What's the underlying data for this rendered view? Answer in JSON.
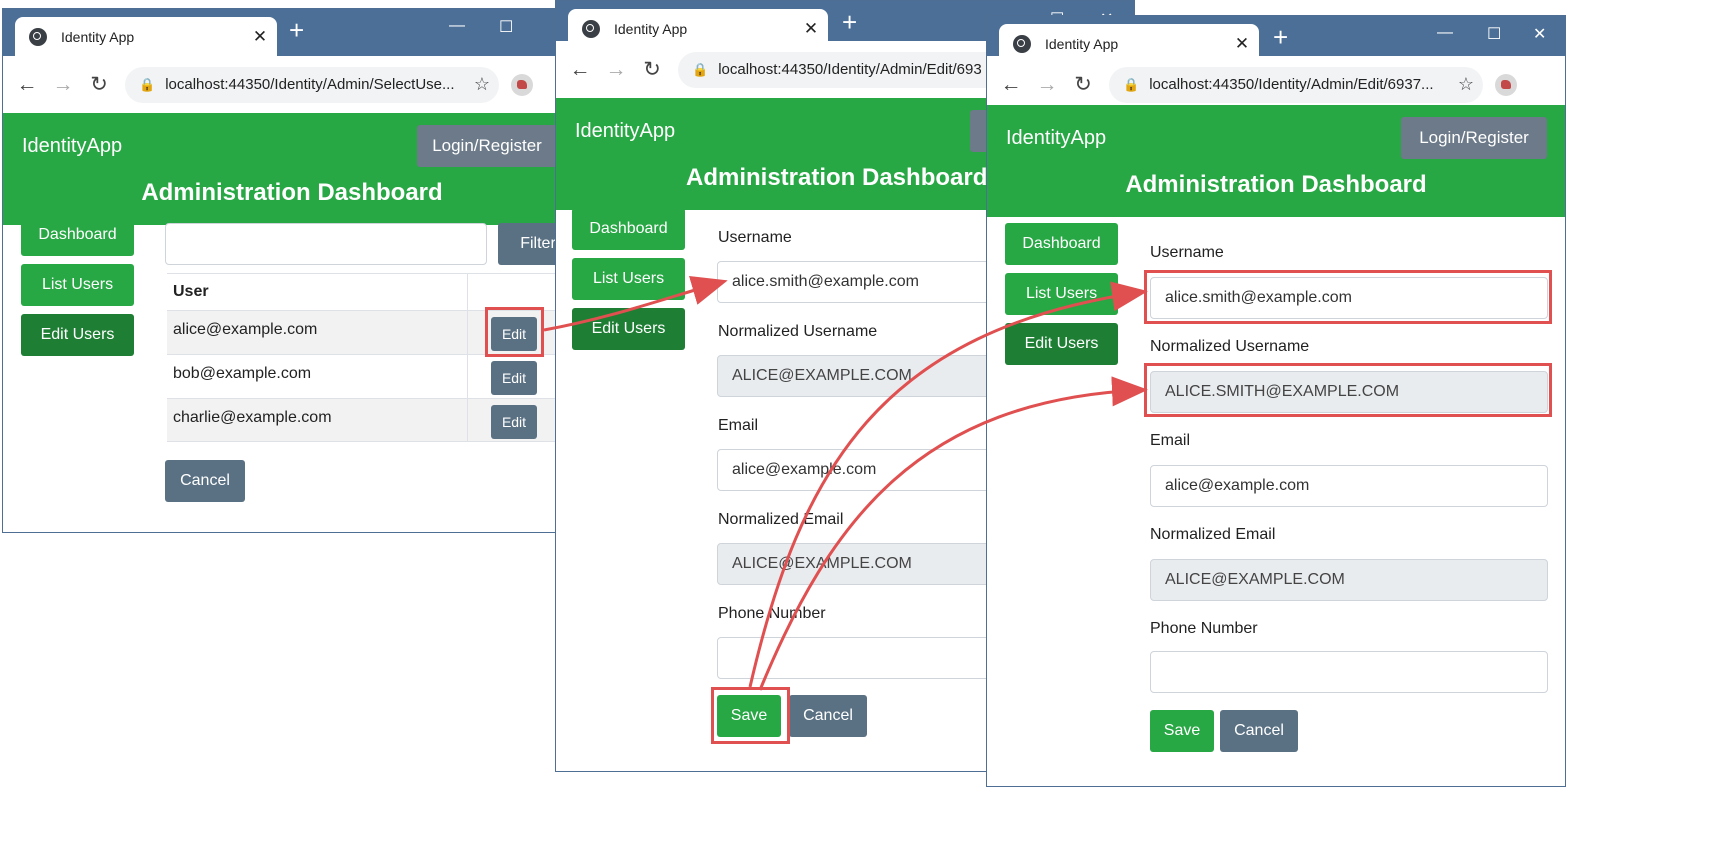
{
  "windows": [
    {
      "tab_title": "Identity App",
      "url": "localhost:44350/Identity/Admin/SelectUse...",
      "brand": "IdentityApp",
      "login_label": "Login/Register",
      "dashboard_title": "Administration Dashboard",
      "sidebar": [
        "Dashboard",
        "List Users",
        "Edit Users"
      ],
      "filter_value": "",
      "filter_label": "Filter",
      "table_header": "User",
      "rows": [
        {
          "user": "alice@example.com",
          "action": "Edit"
        },
        {
          "user": "bob@example.com",
          "action": "Edit"
        },
        {
          "user": "charlie@example.com",
          "action": "Edit"
        }
      ],
      "cancel_label": "Cancel"
    },
    {
      "tab_title": "Identity App",
      "url": "localhost:44350/Identity/Admin/Edit/693",
      "brand": "IdentityApp",
      "dashboard_title": "Administration Dashboard",
      "sidebar": [
        "Dashboard",
        "List Users",
        "Edit Users"
      ],
      "form": {
        "username_label": "Username",
        "username": "alice.smith@example.com",
        "normalized_username_label": "Normalized Username",
        "normalized_username": "ALICE@EXAMPLE.COM",
        "email_label": "Email",
        "email": "alice@example.com",
        "normalized_email_label": "Normalized Email",
        "normalized_email": "ALICE@EXAMPLE.COM",
        "phone_label": "Phone Number",
        "phone": ""
      },
      "save_label": "Save",
      "cancel_label": "Cancel"
    },
    {
      "tab_title": "Identity App",
      "url": "localhost:44350/Identity/Admin/Edit/6937...",
      "brand": "IdentityApp",
      "login_label": "Login/Register",
      "dashboard_title": "Administration Dashboard",
      "sidebar": [
        "Dashboard",
        "List Users",
        "Edit Users"
      ],
      "form": {
        "username_label": "Username",
        "username": "alice.smith@example.com",
        "normalized_username_label": "Normalized Username",
        "normalized_username": "ALICE.SMITH@EXAMPLE.COM",
        "email_label": "Email",
        "email": "alice@example.com",
        "normalized_email_label": "Normalized Email",
        "normalized_email": "ALICE@EXAMPLE.COM",
        "phone_label": "Phone Number",
        "phone": ""
      },
      "save_label": "Save",
      "cancel_label": "Cancel"
    }
  ],
  "window_controls": {
    "minimize": "—",
    "maximize": "☐",
    "close": "✕"
  },
  "icons": {
    "back": "arrow-left-icon",
    "forward": "arrow-right-icon",
    "reload": "reload-icon",
    "lock": "lock-icon",
    "star": "star-icon",
    "globe": "globe-icon"
  },
  "colors": {
    "brand_green": "#28a745",
    "active_green": "#1e7e34",
    "secondary": "#5a7184",
    "highlight": "#e05050",
    "chrome_tabbar": "#4c6f97"
  }
}
